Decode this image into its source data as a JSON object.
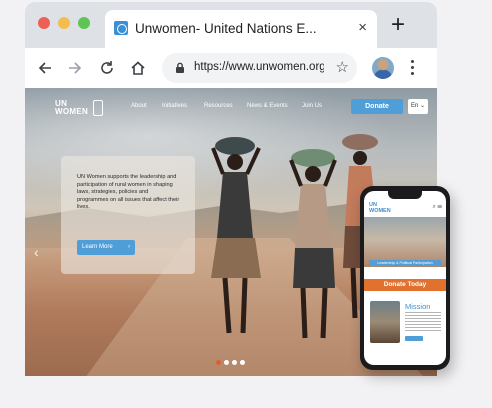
{
  "browser": {
    "tab_title": "Unwomen- United Nations E...",
    "tab_close": "×",
    "new_tab": "+",
    "url": "https://www.unwomen.org/en",
    "bookmark_star": "☆"
  },
  "site": {
    "logo_line1": "UN",
    "logo_line2": "WOMEN",
    "nav": [
      "About",
      "Initiatives",
      "Resources",
      "News & Events",
      "Join Us"
    ],
    "donate_label": "Donate",
    "language": "En",
    "hero_text": "UN Women supports the leadership and participation of rural women in shaping laws, strategies, policies and programmes on all issues that affect their lives.",
    "learn_more": "Learn More",
    "learn_more_arrow": "›",
    "prev_arrow": "‹",
    "slider": {
      "total": 4,
      "active": 1
    }
  },
  "mobile": {
    "logo_line1": "UN",
    "logo_line2": "WOMEN",
    "hero_caption": "Leadership & Political Participation",
    "donate_today": "Donate Today",
    "mission_title": "Mission"
  },
  "colors": {
    "accent_blue": "#4f9ed8",
    "donate_orange": "#e0712e",
    "active_dot": "#e35a2f"
  },
  "icons": [
    "back-arrow-icon",
    "forward-arrow-icon",
    "reload-icon",
    "home-icon",
    "lock-icon",
    "star-icon",
    "profile-avatar",
    "more-vert-icon"
  ]
}
